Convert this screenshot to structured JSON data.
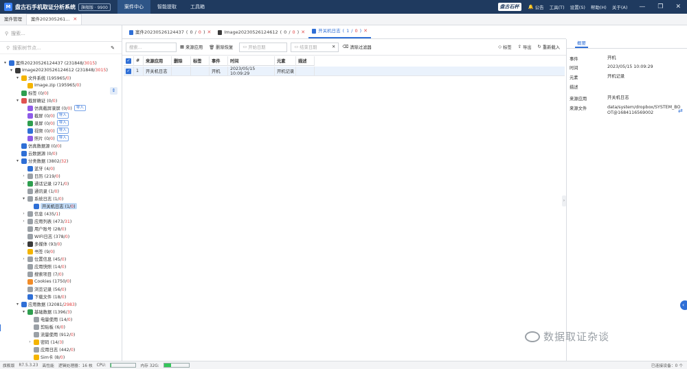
{
  "titlebar": {
    "logo": "M",
    "app_name": "盘古石手机取证分析系统",
    "edition": "旗舰版 · 9900",
    "nav": [
      "案件中心",
      "智能提取",
      "工具箱"
    ],
    "brand": "盘古石杯",
    "right_items": [
      "公告",
      "工具(T)",
      "设置(S)",
      "帮助(H)",
      "关于(A)"
    ],
    "window_controls": [
      "—",
      "❐",
      "✕"
    ]
  },
  "case_tabs": [
    "案件管理",
    "案件202305261..."
  ],
  "left": {
    "search_placeholder": "搜索...",
    "node_search_placeholder": "搜索树节点..."
  },
  "tree": [
    {
      "indent": 0,
      "tw": "▾",
      "icon": "#2f6fd6",
      "label": "案件20230526124437",
      "count": "231848",
      "red": "3015"
    },
    {
      "indent": 1,
      "tw": "▾",
      "icon": "#3a3a3a",
      "label": "Image20230526124612",
      "count": "231848",
      "red": "3015"
    },
    {
      "indent": 2,
      "tw": "▾",
      "icon": "#f4b400",
      "label": "文件系统",
      "count": "195965",
      "red": "0"
    },
    {
      "indent": 3,
      "tw": "",
      "icon": "#f4b400",
      "label": "Image.zip",
      "count": "195965",
      "red": "0"
    },
    {
      "indent": 2,
      "tw": "",
      "icon": "#2e9e4f",
      "label": "标签",
      "count": "0",
      "red": "0"
    },
    {
      "indent": 2,
      "tw": "▾",
      "icon": "#e05252",
      "label": "截屏确证",
      "count": "0",
      "red": "0"
    },
    {
      "indent": 3,
      "tw": "",
      "icon": "#8e5be8",
      "label": "仿真截屏录屏",
      "count": "0",
      "red": "0",
      "import": "导入"
    },
    {
      "indent": 3,
      "tw": "",
      "icon": "#8e5be8",
      "label": "截屏",
      "count": "0",
      "red": "0",
      "import": "导入"
    },
    {
      "indent": 3,
      "tw": "",
      "icon": "#2e9e4f",
      "label": "录屏",
      "count": "0",
      "red": "0",
      "import": "导入"
    },
    {
      "indent": 3,
      "tw": "",
      "icon": "#2f6fd6",
      "label": "视频",
      "count": "0",
      "red": "0",
      "import": "导入"
    },
    {
      "indent": 3,
      "tw": "",
      "icon": "#8e5be8",
      "label": "照片",
      "count": "0",
      "red": "0",
      "import": "导入"
    },
    {
      "indent": 2,
      "tw": "",
      "icon": "#2f6fd6",
      "label": "仿真数据源",
      "count": "0",
      "red": "0"
    },
    {
      "indent": 2,
      "tw": "",
      "icon": "#2f6fd6",
      "label": "云数据源",
      "count": "0",
      "red": "0"
    },
    {
      "indent": 2,
      "tw": "▾",
      "icon": "#2f6fd6",
      "label": "分类数据",
      "count": "3802",
      "red": "32"
    },
    {
      "indent": 3,
      "tw": "",
      "icon": "#2f6fd6",
      "label": "蓝牙",
      "count": "4",
      "red": "0"
    },
    {
      "indent": 3,
      "tw": "›",
      "icon": "#9aa0a6",
      "label": "日历",
      "count": "219",
      "red": "0"
    },
    {
      "indent": 3,
      "tw": "›",
      "icon": "#2e9e4f",
      "label": "通话记录",
      "count": "271",
      "red": "0"
    },
    {
      "indent": 3,
      "tw": "",
      "icon": "#9aa0a6",
      "label": "通讯录",
      "count": "1",
      "red": "0"
    },
    {
      "indent": 3,
      "tw": "▾",
      "icon": "#9aa0a6",
      "label": "系统日志",
      "count": "1",
      "red": "0"
    },
    {
      "indent": 4,
      "tw": "",
      "icon": "#2f6fd6",
      "label": "开关机日志",
      "count": "1",
      "red": "0",
      "selected": true
    },
    {
      "indent": 3,
      "tw": "›",
      "icon": "#9aa0a6",
      "label": "信息",
      "count": "435",
      "red": "1"
    },
    {
      "indent": 3,
      "tw": "›",
      "icon": "#9aa0a6",
      "label": "应用列表",
      "count": "473",
      "red": "31"
    },
    {
      "indent": 3,
      "tw": "",
      "icon": "#9aa0a6",
      "label": "用户账号",
      "count": "28",
      "red": "0"
    },
    {
      "indent": 3,
      "tw": "",
      "icon": "#9aa0a6",
      "label": "WIFI日志",
      "count": "378",
      "red": "0"
    },
    {
      "indent": 3,
      "tw": "›",
      "icon": "#3a3a3a",
      "label": "多媒体",
      "count": "93",
      "red": "0"
    },
    {
      "indent": 3,
      "tw": "",
      "icon": "#f4b400",
      "label": "书签",
      "count": "9",
      "red": "0"
    },
    {
      "indent": 3,
      "tw": "›",
      "icon": "#9aa0a6",
      "label": "位置信息",
      "count": "45",
      "red": "0"
    },
    {
      "indent": 3,
      "tw": "",
      "icon": "#9aa0a6",
      "label": "应用快照",
      "count": "14",
      "red": "0"
    },
    {
      "indent": 3,
      "tw": "",
      "icon": "#9aa0a6",
      "label": "搜索项目",
      "count": "7",
      "red": "0"
    },
    {
      "indent": 3,
      "tw": "",
      "icon": "#f28c28",
      "label": "Cookies",
      "count": "1750",
      "red": "0"
    },
    {
      "indent": 3,
      "tw": "",
      "icon": "#9aa0a6",
      "label": "浏览记录",
      "count": "56",
      "red": "0"
    },
    {
      "indent": 3,
      "tw": "",
      "icon": "#2f6fd6",
      "label": "下载文件",
      "count": "18",
      "red": "0"
    },
    {
      "indent": 2,
      "tw": "▾",
      "icon": "#2f6fd6",
      "label": "应用数据",
      "count": "32081",
      "red": "2983"
    },
    {
      "indent": 3,
      "tw": "▾",
      "icon": "#2e9e4f",
      "label": "基础数据",
      "count": "1396",
      "red": "3"
    },
    {
      "indent": 4,
      "tw": "",
      "icon": "#9aa0a6",
      "label": "电量使用",
      "count": "14",
      "red": "0"
    },
    {
      "indent": 4,
      "tw": "",
      "icon": "#9aa0a6",
      "label": "剪贴板",
      "count": "6",
      "red": "0"
    },
    {
      "indent": 4,
      "tw": "",
      "icon": "#9aa0a6",
      "label": "流量使用",
      "count": "912",
      "red": "0"
    },
    {
      "indent": 4,
      "tw": "›",
      "icon": "#f4b400",
      "label": "密码",
      "count": "14",
      "red": "3"
    },
    {
      "indent": 4,
      "tw": "",
      "icon": "#9aa0a6",
      "label": "应用日志",
      "count": "442",
      "red": "0"
    },
    {
      "indent": 4,
      "tw": "",
      "icon": "#f4b400",
      "label": "Sim卡",
      "count": "8",
      "red": "0"
    }
  ],
  "center": {
    "tabs": [
      {
        "icon": "#2f6fd6",
        "label": "案件20230526124437",
        "count": "0",
        "red": "0"
      },
      {
        "icon": "#3a3a3a",
        "label": "Image20230526124612",
        "count": "0",
        "red": "0"
      },
      {
        "icon": "#2f6fd6",
        "label": "开关机日志",
        "count": "1",
        "red": "0",
        "active": true
      }
    ],
    "toolbar": {
      "search_placeholder": "搜索...",
      "source_app": "来源应用",
      "delete_restore": "删除恢复",
      "start_date": "开始日期",
      "end_date": "结束日期",
      "clear_filter": "清除过滤器",
      "tag": "标签",
      "export": "导出",
      "reload": "重新载入"
    },
    "columns": [
      "#",
      "来源应用",
      "删除",
      "标签",
      "事件",
      "时间",
      "元素",
      "描述"
    ],
    "rows": [
      {
        "num": "1",
        "app": "开关机日志",
        "deleted": "",
        "tag": "",
        "event": "开机",
        "time": "2023/05/15 10:09:29",
        "element": "开机记录",
        "desc": ""
      }
    ]
  },
  "details": {
    "tab": "概要",
    "fields": [
      {
        "k": "事件",
        "v": "开机"
      },
      {
        "k": "时间",
        "v": "2023/05/15 10:09:29"
      },
      {
        "k": "元素",
        "v": "开机记录"
      },
      {
        "k": "描述",
        "v": ""
      },
      {
        "k": "来源应用",
        "v": "开关机日志"
      },
      {
        "k": "来源文件",
        "v": "data/system/dropbox/SYSTEM_BOOT@1684116569002"
      }
    ]
  },
  "watermark": "数据取证杂谈",
  "status": {
    "edition": "旗舰版",
    "version": "R7.5.3.23",
    "mode": "高性能",
    "processors": "逻辑处理器：16 核",
    "cpu_label": "CPU:",
    "cpu_pct": 2,
    "mem_label": "内存 32G:",
    "mem_pct": 30,
    "devices": "已连接设备：0 个"
  }
}
